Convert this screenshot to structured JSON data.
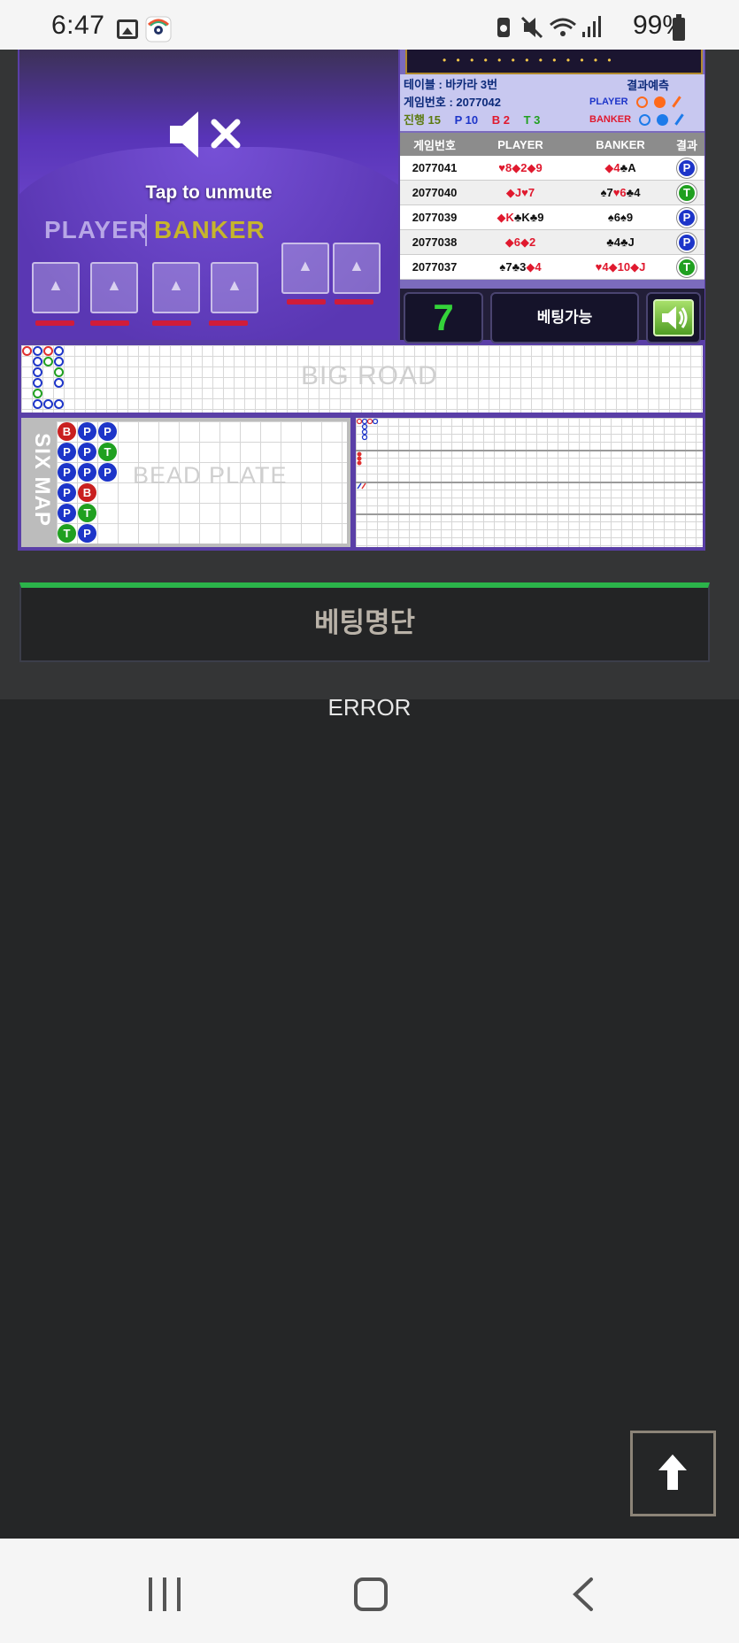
{
  "status_bar": {
    "time": "6:47",
    "battery": "99%",
    "icons": [
      "gallery-icon",
      "app-icon",
      "battery-saver-icon",
      "mute-icon",
      "wifi-icon",
      "signal-icon",
      "battery-icon"
    ]
  },
  "video": {
    "unmute_label": "Tap to unmute",
    "felt_player": "PLAYER",
    "felt_banker": "BANKER"
  },
  "info": {
    "table_label": "테이블 : 바카라 3번",
    "game_no_label": "게임번호 : 2077042",
    "progress_label": "진행 15",
    "p_count": "P 10",
    "b_count": "B 2",
    "t_count": "T 3",
    "predict_label": "결과예측",
    "legend_player": "PLAYER",
    "legend_banker": "BANKER",
    "colors": {
      "player": "#1d35c9",
      "banker": "#c92020",
      "tie": "#20a020",
      "accent_green": "#2bb44a"
    }
  },
  "table": {
    "headers": [
      "게임번호",
      "PLAYER",
      "BANKER",
      "결과"
    ],
    "rows": [
      {
        "game": "2077041",
        "player": [
          [
            "♥8",
            "red"
          ],
          [
            "◆2",
            "red"
          ],
          [
            "◆9",
            "red"
          ]
        ],
        "banker": [
          [
            "◆4",
            "red"
          ],
          [
            "♣A",
            "blk"
          ]
        ],
        "result": "P"
      },
      {
        "game": "2077040",
        "player": [
          [
            "◆J",
            "red"
          ],
          [
            "♥7",
            "red"
          ]
        ],
        "banker": [
          [
            "♠7",
            "blk"
          ],
          [
            "♥6",
            "red"
          ],
          [
            "♣4",
            "blk"
          ]
        ],
        "result": "T"
      },
      {
        "game": "2077039",
        "player": [
          [
            "◆K",
            "red"
          ],
          [
            "♣K",
            "blk"
          ],
          [
            "♣9",
            "blk"
          ]
        ],
        "banker": [
          [
            "♠6",
            "blk"
          ],
          [
            "♠9",
            "blk"
          ]
        ],
        "result": "P"
      },
      {
        "game": "2077038",
        "player": [
          [
            "◆6",
            "red"
          ],
          [
            "◆2",
            "red"
          ]
        ],
        "banker": [
          [
            "♣4",
            "blk"
          ],
          [
            "♣J",
            "blk"
          ]
        ],
        "result": "P"
      },
      {
        "game": "2077037",
        "player": [
          [
            "♠7",
            "blk"
          ],
          [
            "♣3",
            "blk"
          ],
          [
            "◆4",
            "red"
          ]
        ],
        "banker": [
          [
            "♥4",
            "red"
          ],
          [
            "◆10",
            "red"
          ],
          [
            "◆J",
            "red"
          ]
        ],
        "result": "T"
      }
    ]
  },
  "controls": {
    "count": "7",
    "status": "베팅가능"
  },
  "roads": {
    "big_road_label": "BIG ROAD",
    "six_map_label": "SIX MAP",
    "bead_plate_label": "BEAD PLATE",
    "bead_plate": [
      [
        "B",
        "P",
        "P"
      ],
      [
        "P",
        "P",
        "T"
      ],
      [
        "P",
        "P",
        "P"
      ],
      [
        "P",
        "B"
      ],
      [
        "P",
        "T"
      ],
      [
        "T",
        "P"
      ]
    ]
  },
  "betting_list": {
    "title": "베팅명단"
  },
  "error_text": "ERROR",
  "scroll_top_icon": "arrow-up-icon",
  "nav_bar": {
    "icons": [
      "recent-apps-icon",
      "home-icon",
      "back-icon"
    ]
  }
}
